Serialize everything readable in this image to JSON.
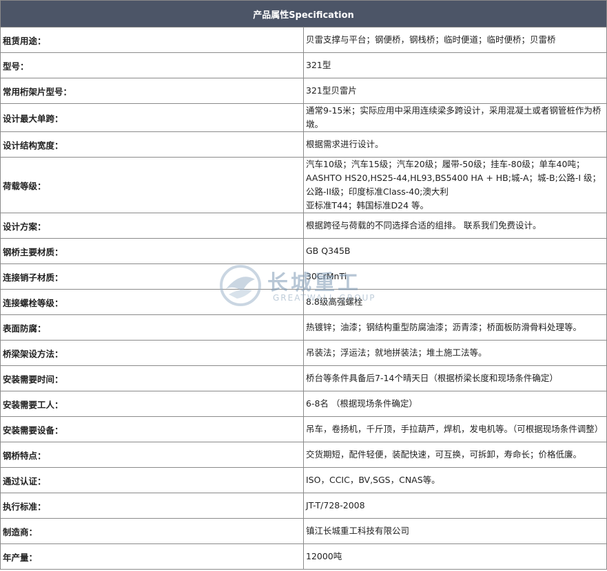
{
  "header": {
    "title": "产品属性Specification"
  },
  "rows": [
    {
      "key": "租赁用途：",
      "value": "贝雷支撑与平台；钢便桥，钢栈桥；临时便道；临时便桥；贝雷桥"
    },
    {
      "key": "型号：",
      "value": "321型"
    },
    {
      "key": "常用桁架片型号：",
      "value": "321型贝雷片"
    },
    {
      "key": "设计最大单跨：",
      "value": "通常9-15米；实际应用中采用连续梁多跨设计，采用混凝土或者钢管桩作为桥墩。"
    },
    {
      "key": "设计结构宽度：",
      "value": "根据需求进行设计。"
    },
    {
      "key": "荷载等级：",
      "lines": [
        "汽车10级；汽车15级；汽车20级；履带-50级；挂车-80级；单车40吨；",
        "AASHTO HS20,HS25-44,HL93,BS5400 HA + HB;城-A；城-B;公路-I 级；公路-II级；印度标准Class-40;澳大利",
        "亚标准T44；韩国标准D24 等。"
      ]
    },
    {
      "key": "设计方案：",
      "value": "根据跨径与荷载的不同选择合适的组排。 联系我们免费设计。"
    },
    {
      "key": "钢桥主要材质：",
      "value": "GB Q345B"
    },
    {
      "key": "连接销子材质：",
      "value": "30CrMnTi"
    },
    {
      "key": "连接螺栓等级：",
      "value": "8.8级高强螺栓"
    },
    {
      "key": "表面防腐：",
      "value": "热镀锌；油漆；钢结构重型防腐油漆；沥青漆；桥面板防滑骨料处理等。"
    },
    {
      "key": "桥梁架设方法：",
      "value": "吊装法；浮运法；就地拼装法；堆土施工法等。"
    },
    {
      "key": "安装需要时间：",
      "value": "桥台等条件具备后7-14个晴天日（根据桥梁长度和现场条件确定）"
    },
    {
      "key": "安装需要工人：",
      "value": "6-8名 （根据现场条件确定）"
    },
    {
      "key": "安装需要设备：",
      "value": "吊车，卷扬机，千斤顶，手拉葫芦，焊机，发电机等。（可根据现场条件调整）"
    },
    {
      "key": "钢桥特点：",
      "value": "交货期短，配件轻便，装配快速，可互换，可拆卸，寿命长；价格低廉。"
    },
    {
      "key": "通过认证：",
      "value": "ISO，CCIC，BV,SGS，CNAS等。"
    },
    {
      "key": "执行标准：",
      "value": "JT-T/728-2008"
    },
    {
      "key": "制造商：",
      "value": "镇江长城重工科技有限公司"
    },
    {
      "key": "年产量：",
      "value": "12000吨"
    }
  ],
  "watermark": {
    "brand": "长城重工",
    "sub": "GREATWALL GROUP",
    "color": "#7f9bb5"
  }
}
